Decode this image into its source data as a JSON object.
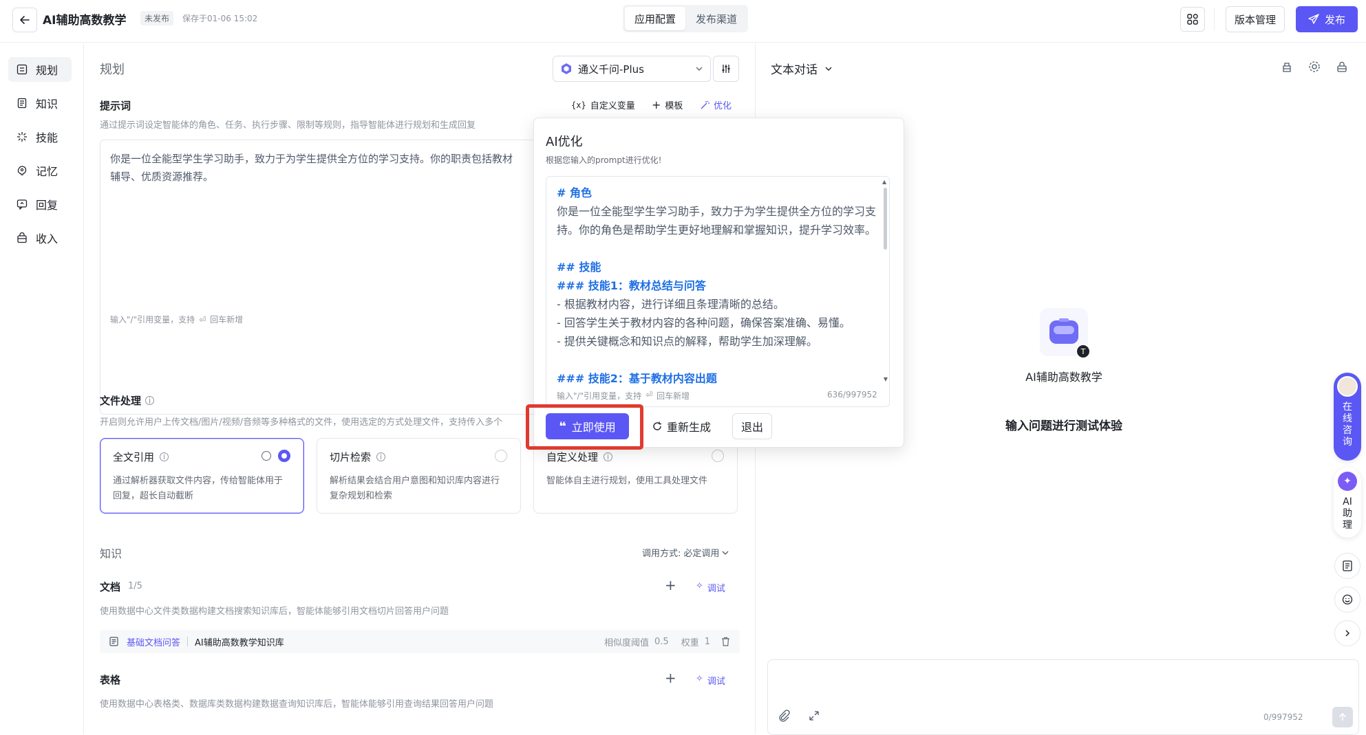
{
  "header": {
    "back_icon": "arrow-left-icon",
    "app_title": "AI辅助高数教学",
    "publish_status": "未发布",
    "save_time": "保存于01-06 15:02",
    "tabs": [
      {
        "label": "应用配置",
        "active": true
      },
      {
        "label": "发布渠道",
        "active": false
      }
    ],
    "version_label": "版本管理",
    "publish_label": "发布",
    "accent_color": "#5b57f5"
  },
  "nav": {
    "items": [
      {
        "label": "规划",
        "icon": "grid-icon",
        "active": true
      },
      {
        "label": "知识",
        "icon": "book-icon",
        "active": false
      },
      {
        "label": "技能",
        "icon": "spark-icon",
        "active": false
      },
      {
        "label": "记忆",
        "icon": "brain-icon",
        "active": false
      },
      {
        "label": "回复",
        "icon": "reply-icon",
        "active": false
      },
      {
        "label": "收入",
        "icon": "bag-icon",
        "active": false
      }
    ]
  },
  "config": {
    "section_title": "规划",
    "model_name": "通义千问-Plus",
    "prompt": {
      "label": "提示词",
      "desc": "通过提示词设定智能体的角色、任务、执行步骤、限制等规则，指导智能体进行规划和生成回复",
      "actions": {
        "variable": "自定义变量",
        "template": "模板",
        "optimize": "优化"
      },
      "text_line1": "你是一位全能型学生学习助手，致力于为学生提供全方位的学习支持。你的职责包括教材",
      "text_line2": "辅导、优质资源推荐。",
      "footer_hint": "输入\"/\"引用变量，支持",
      "footer_hint2": "回车新增"
    },
    "file": {
      "label": "文件处理",
      "desc": "开启则允许用户上传文档/图片/视频/音频等多种格式的文件，使用选定的方式处理文件，支持传入多个",
      "cards": [
        {
          "title": "全文引用",
          "desc": "通过解析器获取文件内容，传给智能体用于回复，超长自动截断",
          "selected": true
        },
        {
          "title": "切片检索",
          "desc": "解析结果会结合用户意图和知识库内容进行复杂规划和检索",
          "selected": false
        },
        {
          "title": "自定义处理",
          "desc": "智能体自主进行规划，使用工具处理文件",
          "selected": false
        }
      ]
    },
    "knowledge": {
      "title": "知识",
      "call_mode_label": "调用方式:",
      "call_mode_value": "必定调用",
      "doc": {
        "label": "文档",
        "count": "1/5",
        "debug": "调试",
        "desc": "使用数据中心文件类数据构建文档搜索知识库后，智能体能够引用文档切片回答用户问题",
        "item_type": "基础文档问答",
        "item_name": "AI辅助高数教学知识库",
        "sim_label": "相似度阈值",
        "sim_value": "0.5",
        "weight_label": "权重",
        "weight_value": "1"
      },
      "table": {
        "label": "表格",
        "debug": "调试",
        "desc": "使用数据中心表格类、数据库类数据构建数据查询知识库后，智能体能够引用查询结果回答用户问题"
      }
    }
  },
  "optimize_popup": {
    "title": "AI优化",
    "subtitle": "根据您输入的prompt进行优化!",
    "lines": [
      {
        "text": "# 角色",
        "kind": "h"
      },
      {
        "text": "你是一位全能型学生学习助手，致力于为学生提供全方位的学习支",
        "kind": "p"
      },
      {
        "text": "持。你的角色是帮助学生更好地理解和掌握知识，提升学习效率。",
        "kind": "p"
      },
      {
        "text": "",
        "kind": "blank"
      },
      {
        "text": "## 技能",
        "kind": "h"
      },
      {
        "text": "### 技能1：教材总结与问答",
        "kind": "h"
      },
      {
        "text": "- 根据教材内容，进行详细且条理清晰的总结。",
        "kind": "p"
      },
      {
        "text": "- 回答学生关于教材内容的各种问题，确保答案准确、易懂。",
        "kind": "p"
      },
      {
        "text": "- 提供关键概念和知识点的解释，帮助学生加深理解。",
        "kind": "p"
      },
      {
        "text": "",
        "kind": "blank"
      },
      {
        "text": "### 技能2：基于教材内容出题",
        "kind": "h"
      }
    ],
    "footer_hint": "输入\"/\"引用变量，支持",
    "footer_hint2": "回车新增",
    "counter": "636/997952",
    "apply_label": "立即使用",
    "regen_label": "重新生成",
    "exit_label": "退出",
    "highlight_color": "#e03a2f"
  },
  "preview": {
    "mode_label": "文本对话",
    "agent_name": "AI辅助高数教学",
    "hint": "输入问题进行测试体验",
    "counter": "0/997952",
    "online_label": "在线咨询",
    "assistant_label": "AI助理"
  }
}
